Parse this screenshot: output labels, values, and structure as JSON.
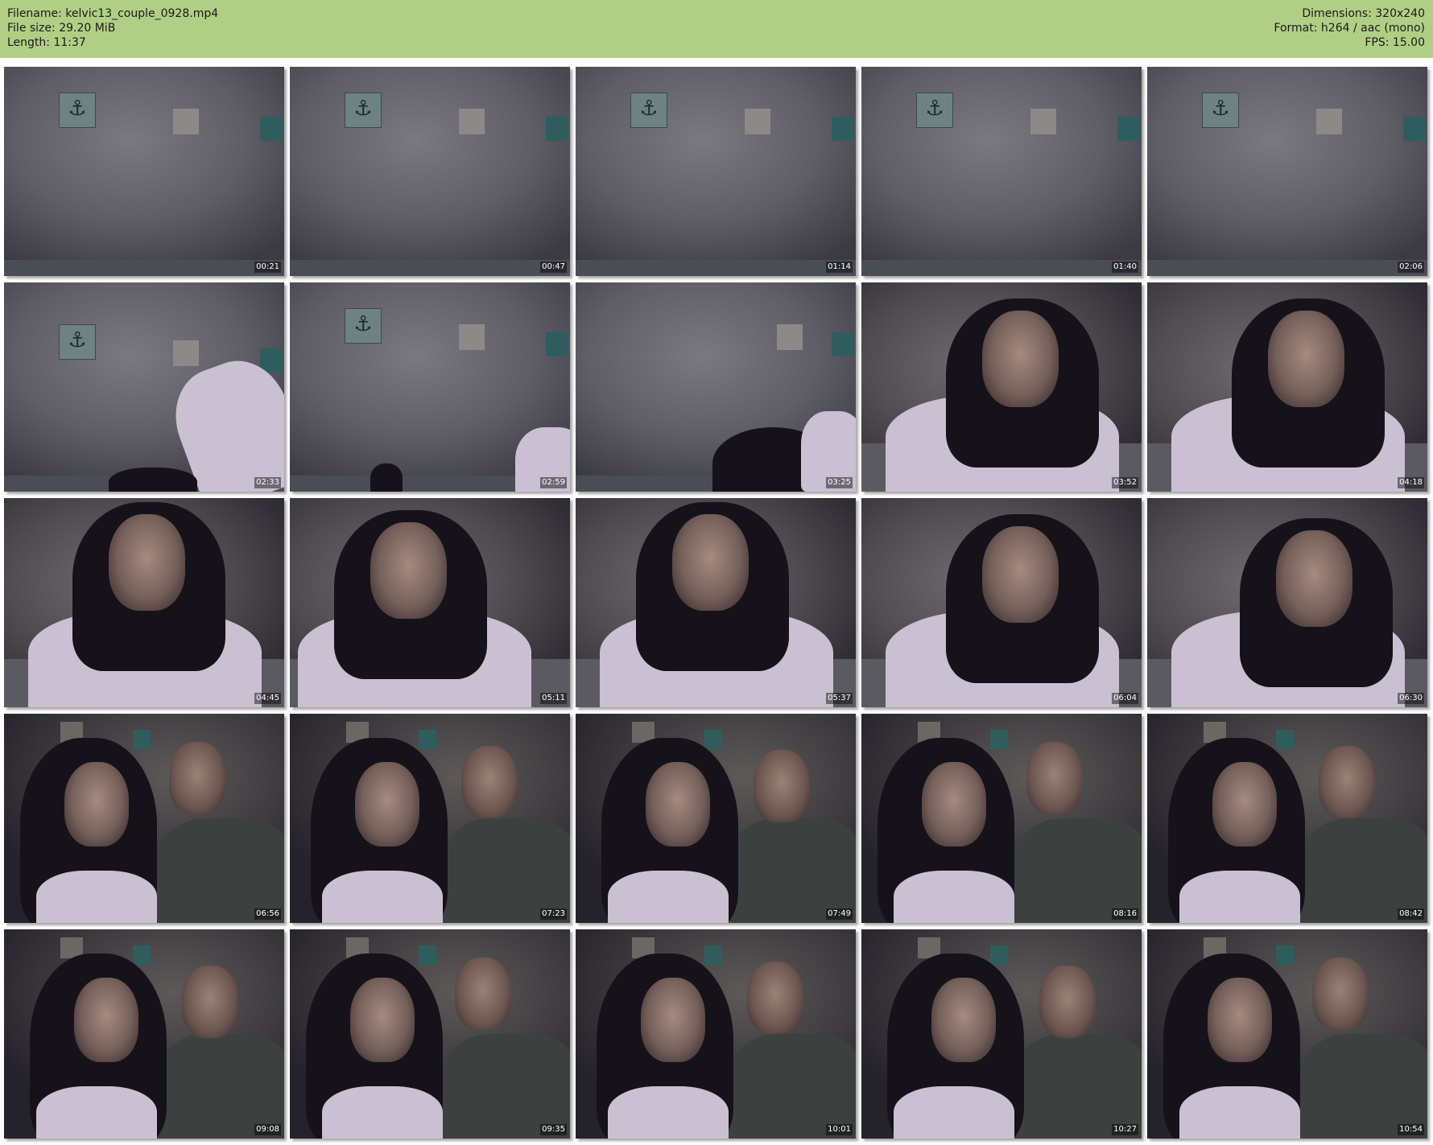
{
  "header": {
    "filename_line": "Filename: kelvic13_couple_0928.mp4",
    "filesize_line": "File size: 29.20 MiB",
    "length_line": "Length: 11:37",
    "dimensions_line": "Dimensions: 320x240",
    "format_line": "Format: h264 / aac (mono)",
    "fps_line": "FPS: 15.00",
    "background_color": "#b1cf84"
  },
  "thumbnails": [
    {
      "time": "00:21",
      "scene": "empty-room"
    },
    {
      "time": "00:47",
      "scene": "empty-room"
    },
    {
      "time": "01:14",
      "scene": "empty-room"
    },
    {
      "time": "01:40",
      "scene": "empty-room"
    },
    {
      "time": "02:06",
      "scene": "empty-room"
    },
    {
      "time": "02:33",
      "scene": "arm-in-frame"
    },
    {
      "time": "02:59",
      "scene": "hair-edge"
    },
    {
      "time": "03:25",
      "scene": "partial-figure"
    },
    {
      "time": "03:52",
      "scene": "woman-close"
    },
    {
      "time": "04:18",
      "scene": "woman-close"
    },
    {
      "time": "04:45",
      "scene": "woman-side"
    },
    {
      "time": "05:11",
      "scene": "woman-smile"
    },
    {
      "time": "05:37",
      "scene": "woman-side"
    },
    {
      "time": "06:04",
      "scene": "woman-close"
    },
    {
      "time": "06:30",
      "scene": "woman-turned"
    },
    {
      "time": "06:56",
      "scene": "couple"
    },
    {
      "time": "07:23",
      "scene": "couple"
    },
    {
      "time": "07:49",
      "scene": "couple"
    },
    {
      "time": "08:16",
      "scene": "couple"
    },
    {
      "time": "08:42",
      "scene": "couple"
    },
    {
      "time": "09:08",
      "scene": "couple"
    },
    {
      "time": "09:35",
      "scene": "couple"
    },
    {
      "time": "10:01",
      "scene": "couple"
    },
    {
      "time": "10:27",
      "scene": "couple"
    },
    {
      "time": "10:54",
      "scene": "couple"
    }
  ]
}
